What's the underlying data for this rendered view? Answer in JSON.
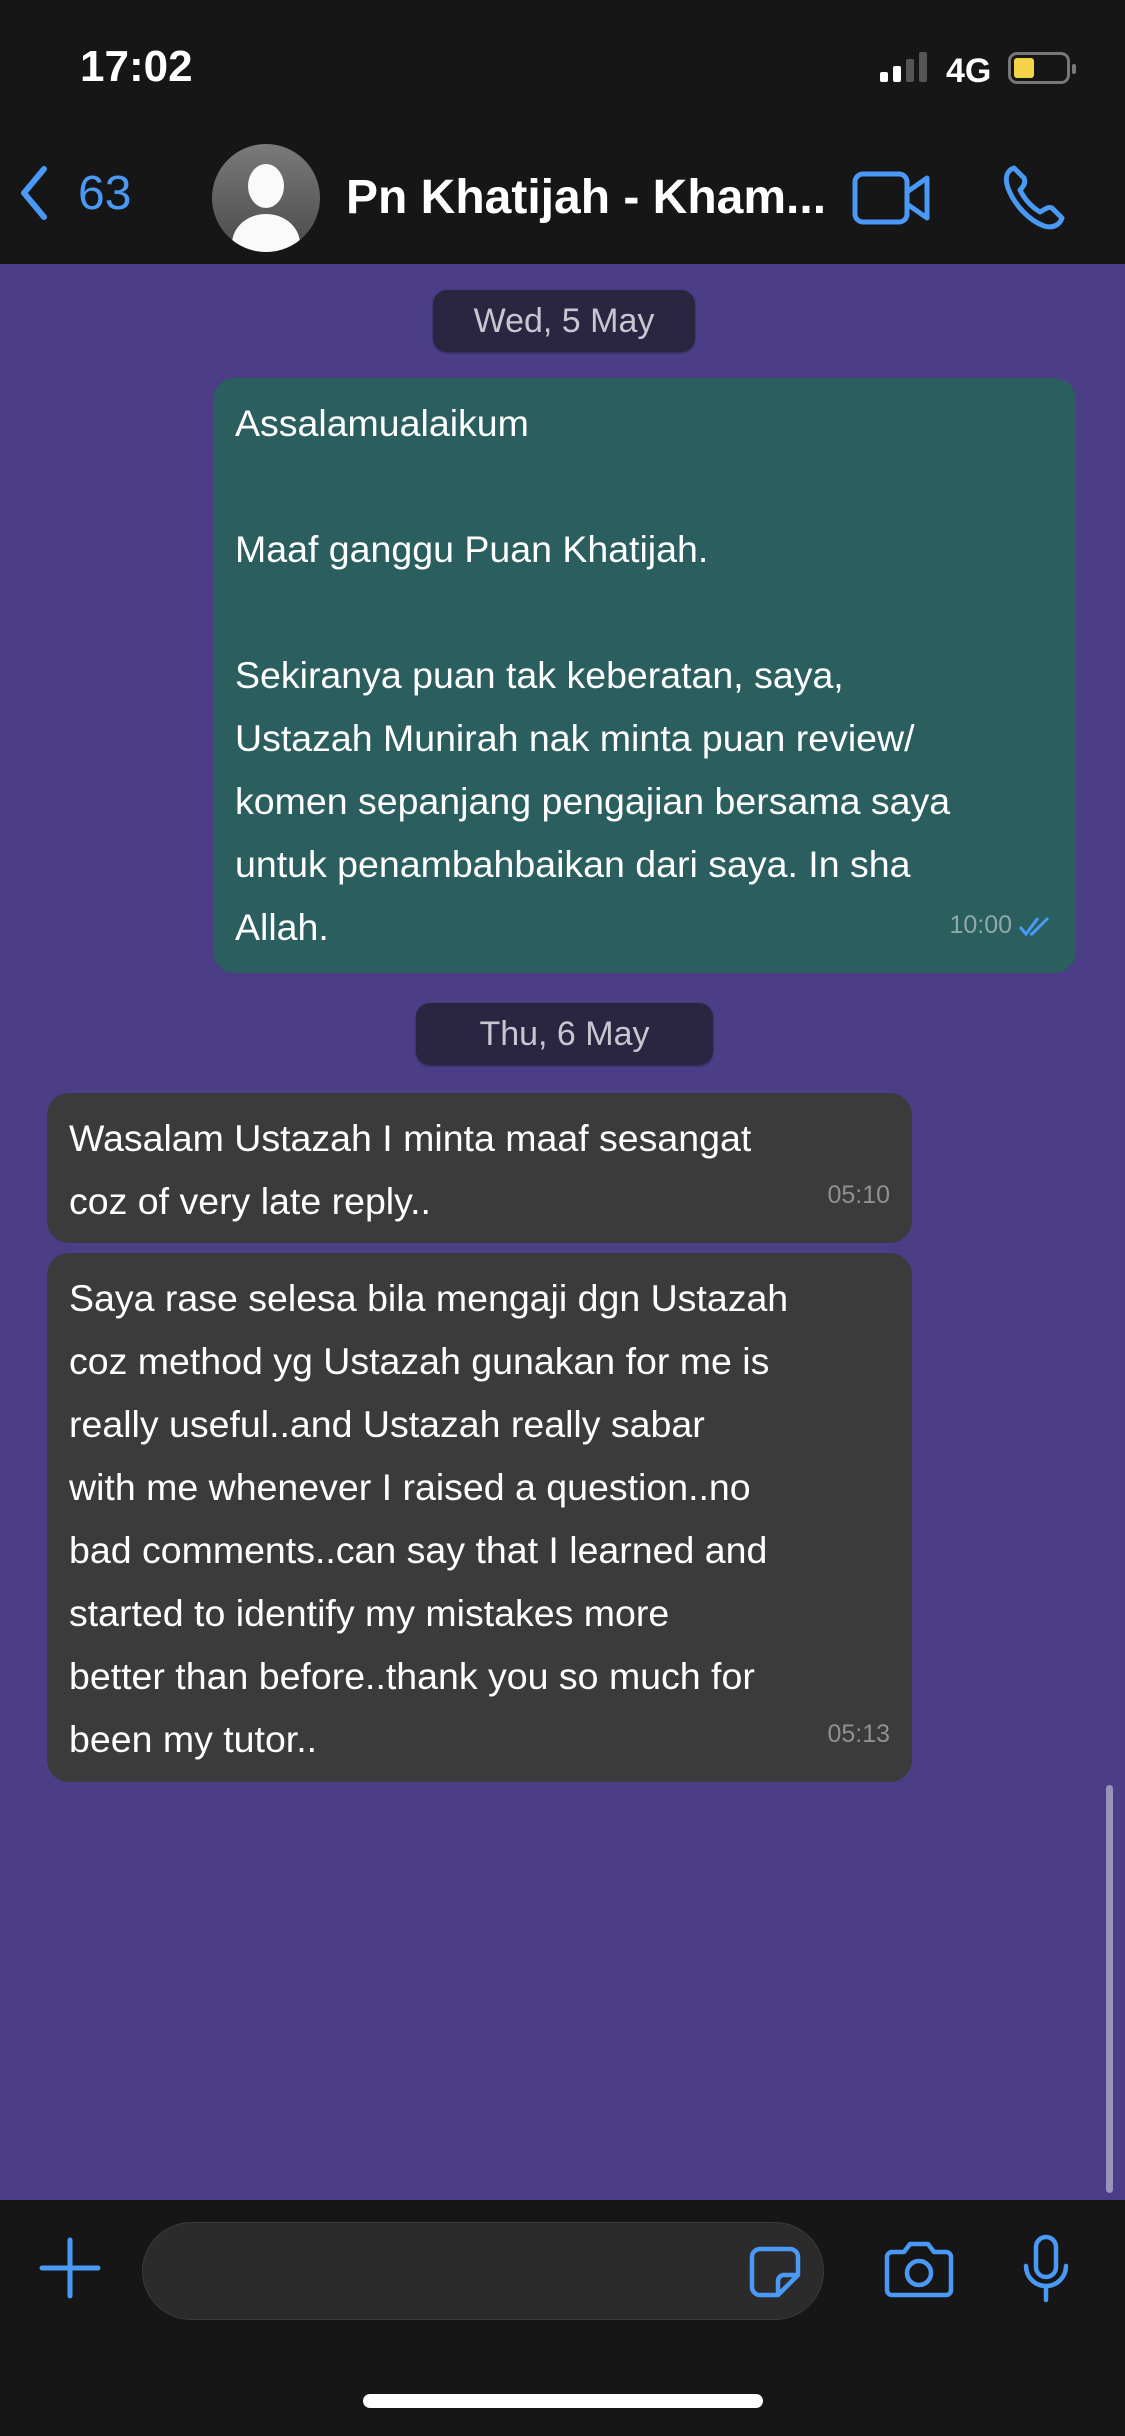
{
  "status_bar": {
    "time": "17:02",
    "network": "4G",
    "battery_level": 0.3
  },
  "header": {
    "back_count": "63",
    "contact_name": "Pn Khatijah - Kham..."
  },
  "colors": {
    "accent": "#4a9af5",
    "background": "#4b3e86",
    "outgoing": "#2b5f5f",
    "incoming": "#3b3b3b"
  },
  "messages": [
    {
      "type": "date",
      "text": "Wed, 5 May"
    },
    {
      "type": "outgoing",
      "lines": [
        "Assalamualaikum",
        "",
        "Maaf ganggu Puan Khatijah.",
        "",
        "Sekiranya puan tak keberatan, saya,",
        "Ustazah Munirah nak minta puan review/",
        "komen sepanjang pengajian bersama saya",
        "untuk penambahbaikan dari saya. In sha",
        "Allah."
      ],
      "time": "10:00",
      "status": "read"
    },
    {
      "type": "date",
      "text": "Thu, 6 May"
    },
    {
      "type": "incoming",
      "lines": [
        "Wasalam Ustazah I minta maaf sesangat",
        "coz of very late reply.."
      ],
      "time": "05:10"
    },
    {
      "type": "incoming",
      "lines": [
        "Saya rase selesa bila mengaji dgn Ustazah",
        "coz method yg Ustazah gunakan for me is",
        "really useful..and Ustazah really sabar",
        "with me whenever I raised a question..no",
        "bad comments..can say that I learned and",
        "started to identify my mistakes more",
        "better than before..thank you so much for",
        "been my tutor.."
      ],
      "time": "05:13"
    }
  ]
}
